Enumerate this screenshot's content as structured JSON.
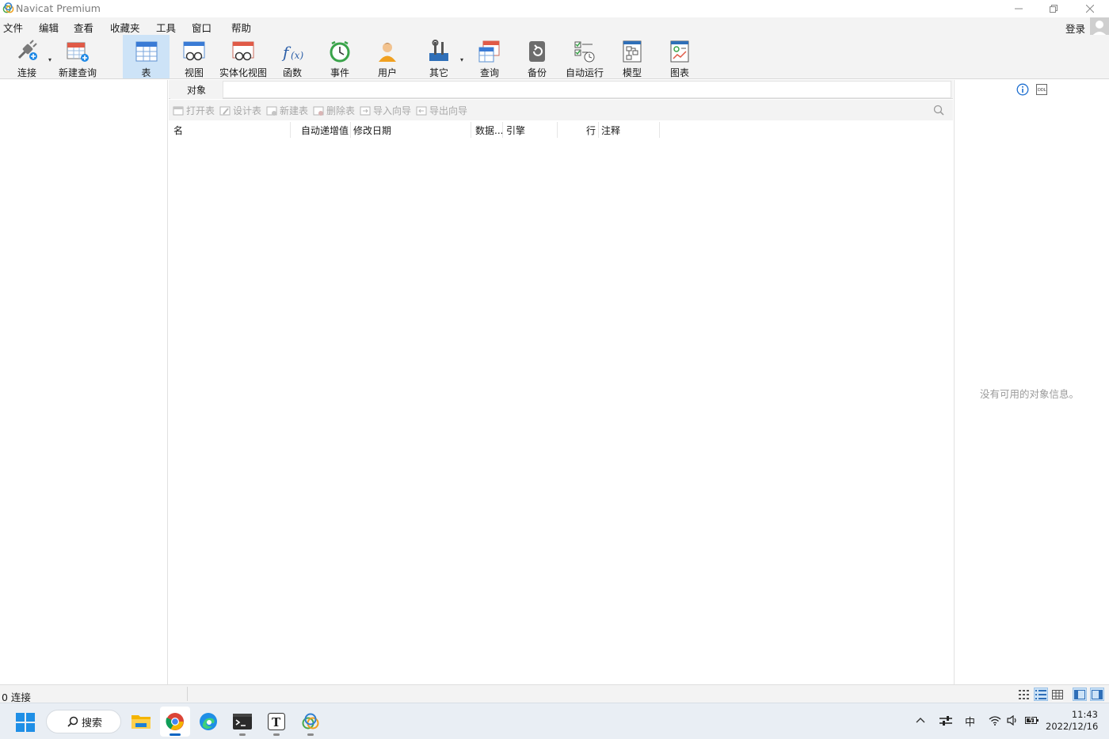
{
  "window": {
    "title": "Navicat Premium",
    "controls": [
      "minimize-icon",
      "restore-icon",
      "close-icon"
    ]
  },
  "menu": {
    "items": [
      "文件",
      "编辑",
      "查看",
      "收藏夹",
      "工具",
      "窗口",
      "帮助"
    ],
    "login": "登录"
  },
  "toolbar": {
    "items": [
      {
        "label": "连接",
        "icon": "connect-plug-icon"
      },
      {
        "label": "新建查询",
        "icon": "new-query-icon"
      },
      {
        "label": "表",
        "icon": "table-icon",
        "active": true
      },
      {
        "label": "视图",
        "icon": "view-icon"
      },
      {
        "label": "实体化视图",
        "icon": "materialized-view-icon"
      },
      {
        "label": "函数",
        "icon": "function-icon"
      },
      {
        "label": "事件",
        "icon": "event-clock-icon"
      },
      {
        "label": "用户",
        "icon": "user-icon"
      },
      {
        "label": "其它",
        "icon": "tools-icon"
      },
      {
        "label": "查询",
        "icon": "query-icon"
      },
      {
        "label": "备份",
        "icon": "backup-icon"
      },
      {
        "label": "自动运行",
        "icon": "automation-icon"
      },
      {
        "label": "模型",
        "icon": "model-icon"
      },
      {
        "label": "图表",
        "icon": "chart-icon"
      }
    ]
  },
  "objects": {
    "tab": "对象",
    "actions": [
      "打开表",
      "设计表",
      "新建表",
      "删除表",
      "导入向导",
      "导出向导"
    ],
    "columns": [
      "名",
      "自动递增值",
      "修改日期",
      "数据...",
      "引擎",
      "行",
      "注释"
    ]
  },
  "info_panel": {
    "empty_message": "没有可用的对象信息。"
  },
  "status": {
    "connections": "0 连接"
  },
  "taskbar": {
    "search_label": "搜索",
    "apps": [
      "file-explorer-icon",
      "chrome-icon",
      "edge-icon",
      "terminal-icon",
      "typora-icon",
      "navicat-icon"
    ],
    "tray": {
      "ime": "中"
    },
    "clock": {
      "time": "11:43",
      "date": "2022/12/16"
    }
  }
}
